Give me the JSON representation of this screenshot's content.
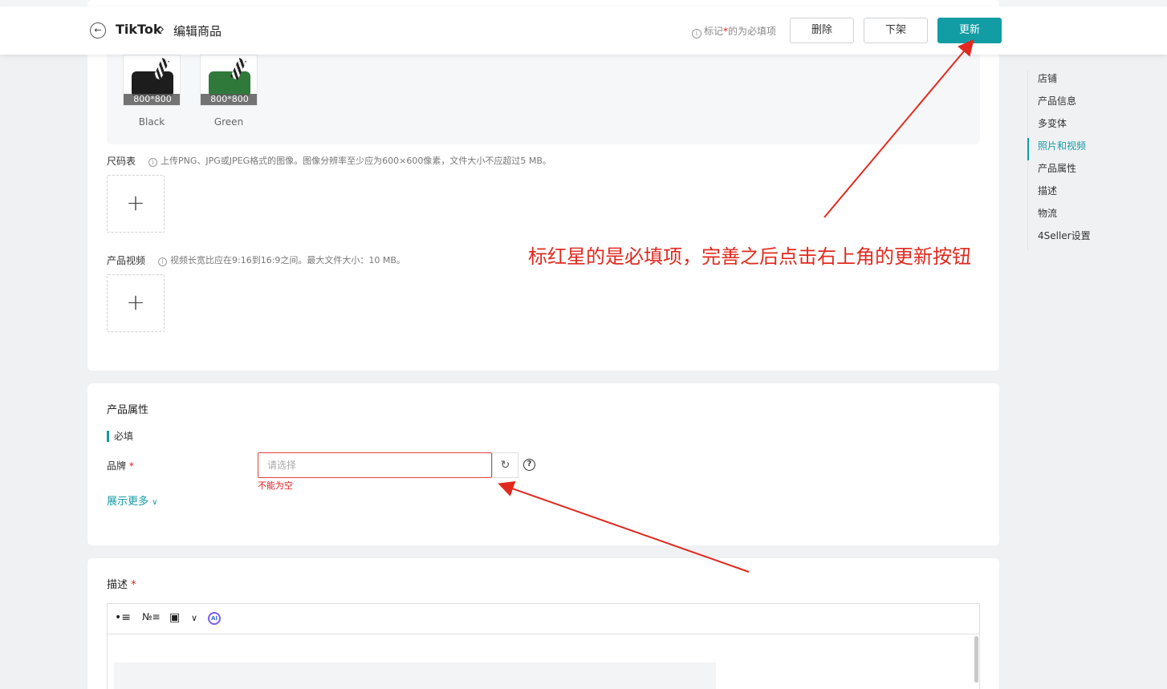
{
  "header": {
    "breadcrumb_app": "TikTok",
    "breadcrumb_sep": "›",
    "breadcrumb_page": "编辑商品",
    "hint_prefix": "标记",
    "hint_star": "*",
    "hint_suffix": "的为必填项",
    "delete_label": "删除",
    "offshelf_label": "下架",
    "update_label": "更新"
  },
  "photos": {
    "variants": [
      {
        "name": "Black",
        "dim": "800*800"
      },
      {
        "name": "Green",
        "dim": "800*800"
      }
    ],
    "size_chart_label": "尺码表",
    "size_chart_hint": "上传PNG、JPG或JPEG格式的图像。图像分辨率至少应为600×600像素，文件大小不应超过5 MB。",
    "video_label": "产品视频",
    "video_hint": "视频长宽比应在9:16到16:9之间。最大文件大小：10 MB。",
    "upload_symbol": "+"
  },
  "attributes": {
    "title": "产品属性",
    "required_tag": "必填",
    "brand_label": "品牌",
    "brand_star": "*",
    "brand_placeholder": "请选择",
    "brand_error": "不能为空",
    "show_more": "展示更多"
  },
  "description": {
    "title": "描述",
    "star": "*",
    "ai_label": "AI"
  },
  "anchor_nav": [
    {
      "label": "店铺",
      "active": false
    },
    {
      "label": "产品信息",
      "active": false
    },
    {
      "label": "多变体",
      "active": false
    },
    {
      "label": "照片和视频",
      "active": true
    },
    {
      "label": "产品属性",
      "active": false
    },
    {
      "label": "描述",
      "active": false
    },
    {
      "label": "物流",
      "active": false
    },
    {
      "label": "4Seller设置",
      "active": false
    }
  ],
  "annotation": {
    "text": "标红星的是必填项，完善之后点击右上角的更新按钮",
    "color": "#e02a1f"
  },
  "colors": {
    "accent": "#129ca4",
    "error": "#e02020"
  }
}
